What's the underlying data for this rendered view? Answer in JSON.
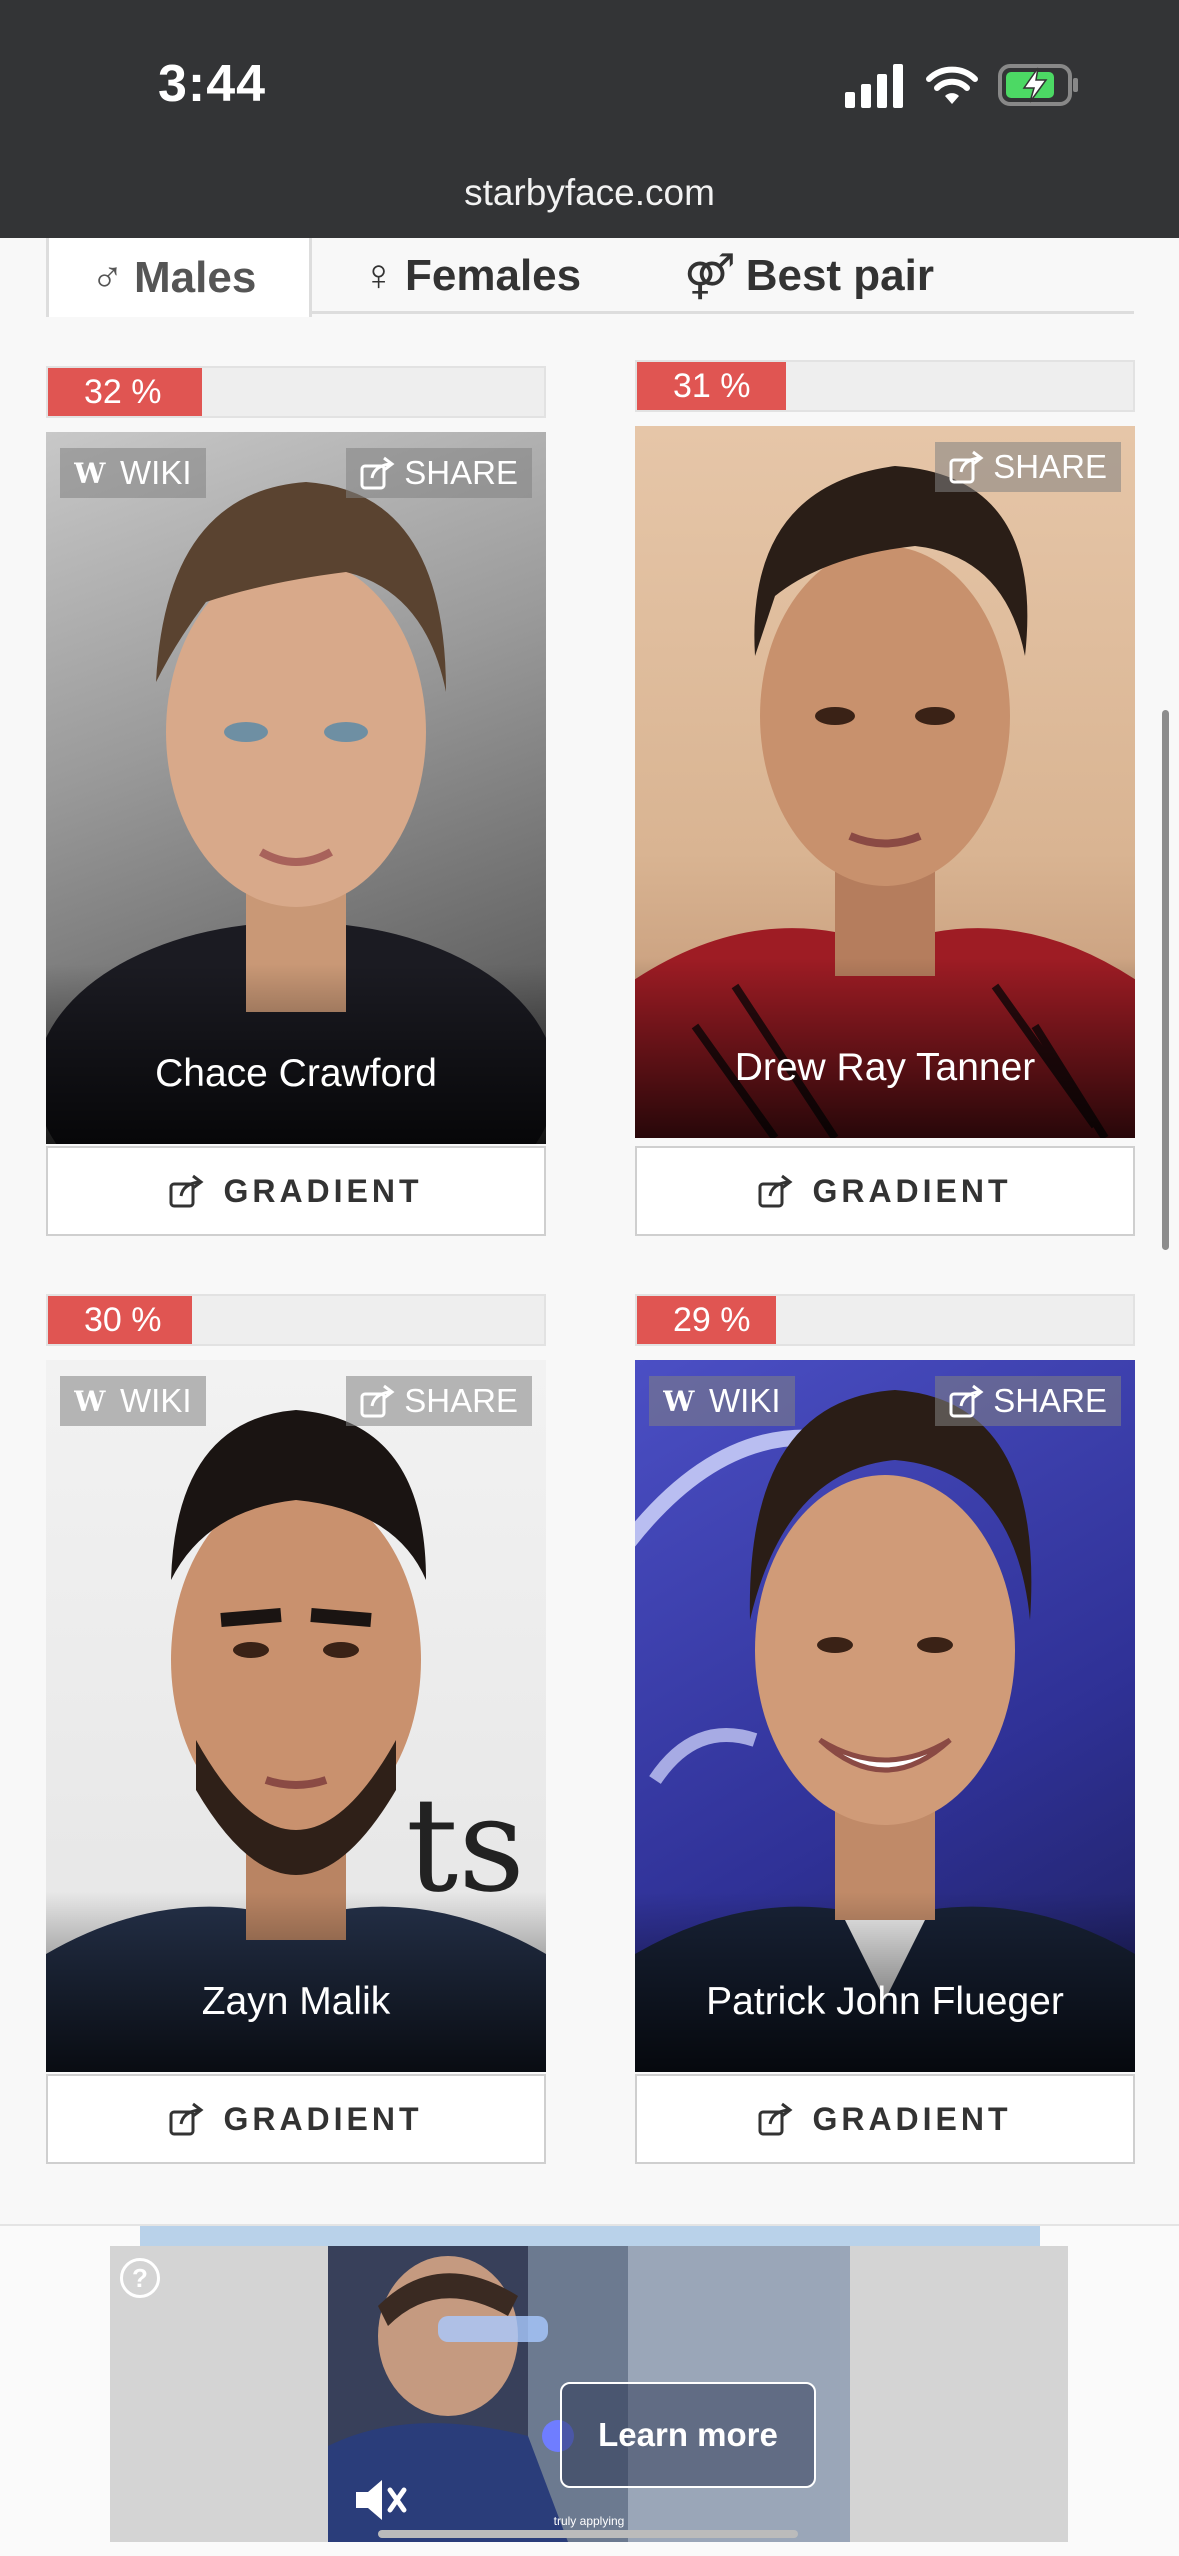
{
  "status": {
    "time": "3:44",
    "domain": "starbyface.com"
  },
  "tabs": [
    {
      "symbol": "♂",
      "label": "Males"
    },
    {
      "symbol": "♀",
      "label": "Females"
    },
    {
      "symbol": "⚤",
      "label": "Best pair"
    }
  ],
  "results": [
    {
      "name": "Chace Crawford",
      "percent_label": "32 %",
      "percent": 32,
      "wiki": "WIKI",
      "share": "SHARE",
      "gradient": "GRADIENT"
    },
    {
      "name": "Drew Ray Tanner",
      "percent_label": "31 %",
      "percent": 31,
      "share": "SHARE",
      "gradient": "GRADIENT"
    },
    {
      "name": "Zayn Malik",
      "percent_label": "30 %",
      "percent": 30,
      "wiki": "WIKI",
      "share": "SHARE",
      "gradient": "GRADIENT"
    },
    {
      "name": "Patrick John Flueger",
      "percent_label": "29 %",
      "percent": 29,
      "wiki": "WIKI",
      "share": "SHARE",
      "gradient": "GRADIENT"
    }
  ],
  "ad": {
    "cta": "Learn more",
    "help": "?",
    "caption": "truly applying"
  },
  "colors": {
    "accent": "#e05552",
    "statusbar": "#333436"
  }
}
